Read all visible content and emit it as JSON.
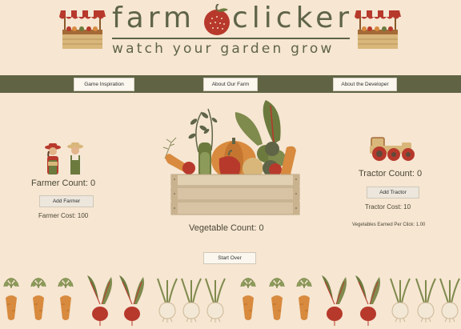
{
  "header": {
    "title_part1": "farm",
    "title_part2": "clicker",
    "subtitle": "watch your garden grow"
  },
  "nav": {
    "inspiration_label": "Game Inspiration",
    "about_farm_label": "About Our Farm",
    "about_dev_label": "About the Developer"
  },
  "farmer": {
    "count_label": "Farmer Count: 0",
    "add_label": "Add Farmer",
    "cost_label": "Farmer Cost: 100"
  },
  "vegetables": {
    "count_label": "Vegetable Count: 0"
  },
  "tractor": {
    "count_label": "Tractor Count: 0",
    "add_label": "Add Tractor",
    "cost_label": "Tractor Cost: 10",
    "per_click_label": "Vegetables Earned Per Click: 1.00"
  },
  "controls": {
    "start_over_label": "Start Over"
  },
  "colors": {
    "background": "#f6e6d2",
    "olive": "#606445",
    "tomato_red": "#b7392c",
    "carrot_orange": "#d88a3e"
  }
}
